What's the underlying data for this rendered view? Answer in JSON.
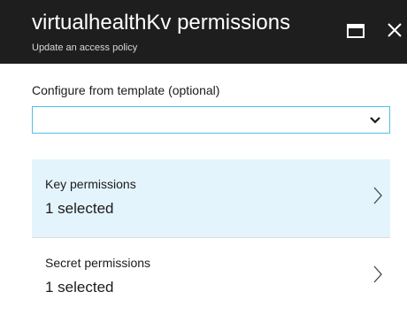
{
  "header": {
    "title": "virtualhealthKv permissions",
    "subtitle": "Update an access policy",
    "maximize_icon": "maximize-icon",
    "close_icon": "close-icon"
  },
  "template": {
    "label": "Configure from template (optional)",
    "value": "",
    "chevron_icon": "chevron-down-icon"
  },
  "permissions": [
    {
      "title": "Key permissions",
      "value": "1 selected",
      "selected": true
    },
    {
      "title": "Secret permissions",
      "value": "1 selected",
      "selected": false
    }
  ],
  "colors": {
    "header_bg": "#1e1e1e",
    "selected_row_bg": "#e4f4fc",
    "focus_border": "#4ebfe8"
  }
}
